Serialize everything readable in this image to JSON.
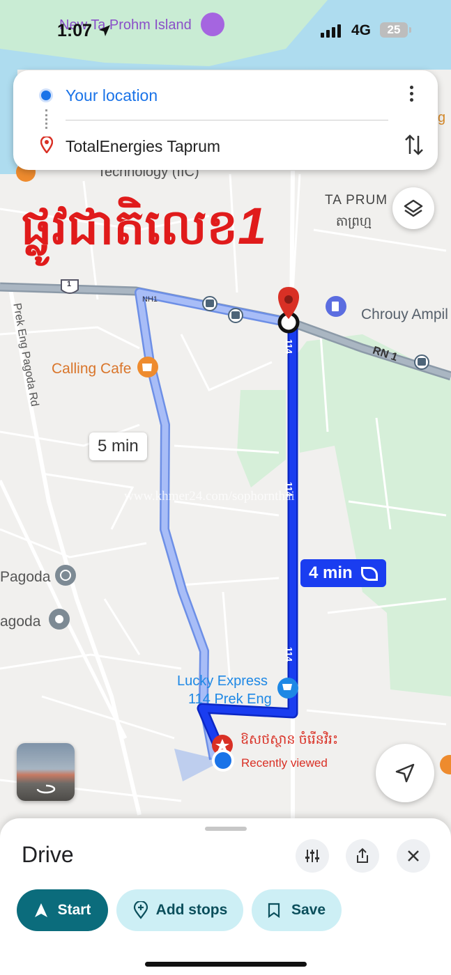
{
  "status_bar": {
    "time": "1:07",
    "network": "4G",
    "battery": "25"
  },
  "directions": {
    "origin": "Your location",
    "destination": "TotalEnergies Taprum"
  },
  "map": {
    "labels": {
      "island": "New Ta Prohm Island",
      "tech": "Technology (IIC)",
      "ta_prum": "TA PRUM",
      "ta_prum_khmer": "តាព្រហ្ម",
      "chrouy": "Chrouy Ampil",
      "calling_cafe": "Calling Cafe",
      "prek_eng_road": "Prek Eng Pagoda Rd",
      "pagoda1": "Pagoda",
      "pagoda2": "agoda",
      "lucky_line1": "Lucky Express",
      "lucky_line2": "114 Prek Eng",
      "pharmacy": "ឱសថស្ថាន ចំរើនវិរះ",
      "recently_viewed": "Recently viewed",
      "rn1": "RN 1",
      "nh1": "NH1",
      "shield_1": "1",
      "road_114": "114",
      "watermark": "www.khmer24.com/sophornthai",
      "edge_g": "g"
    },
    "overlay_title": "ផ្លូវជាតិលេខ",
    "overlay_number": "1",
    "alt_route_time": "5 min",
    "main_route_time": "4 min",
    "colors": {
      "route": "#1a3df0",
      "alt_route": "#a8bdf7",
      "water": "#aedcef",
      "park": "#d6efd9",
      "pin": "#d93025"
    }
  },
  "sheet": {
    "title": "Drive",
    "start": "Start",
    "add_stops": "Add stops",
    "save": "Save"
  }
}
